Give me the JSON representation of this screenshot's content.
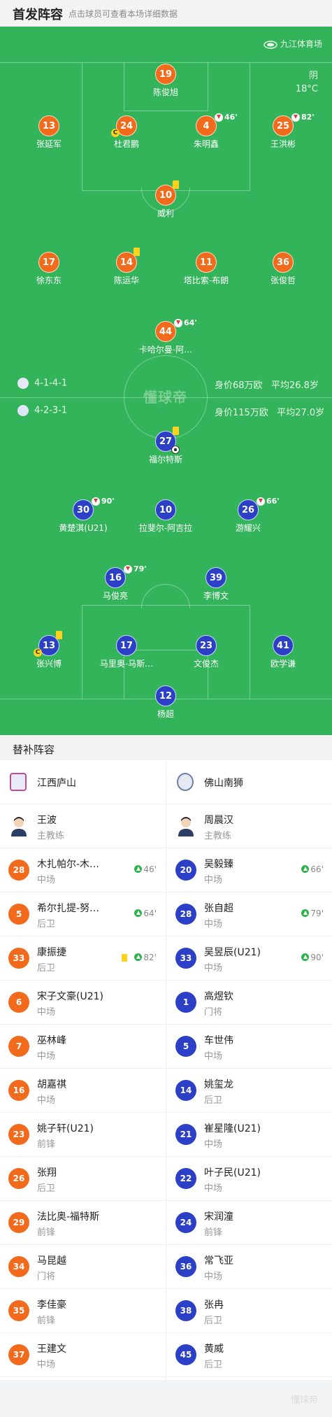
{
  "header": {
    "title": "首发阵容",
    "subtitle": "点击球员可查看本场详细数据"
  },
  "venue": {
    "name": "九江体育场",
    "icon": "stadium-icon"
  },
  "weather": {
    "condition": "阴",
    "temperature": "18°C"
  },
  "watermark": "懂球帝",
  "home_team": {
    "name": "江西庐山",
    "formation": "4-1-4-1",
    "value": "身价68万欧",
    "age": "平均26.8岁",
    "color": "#f26b1d"
  },
  "away_team": {
    "name": "佛山南狮",
    "formation": "4-2-3-1",
    "value": "身价115万欧",
    "age": "平均27.0岁",
    "color": "#2b3fc7"
  },
  "home_lineup": [
    {
      "num": "19",
      "name": "陈俊旭"
    },
    {
      "num": "13",
      "name": "张延军"
    },
    {
      "num": "24",
      "name": "杜君鹏",
      "captain": "C"
    },
    {
      "num": "4",
      "name": "朱明鑫",
      "sub_min": "46'"
    },
    {
      "num": "25",
      "name": "王洪彬",
      "sub_min": "82'"
    },
    {
      "num": "10",
      "name": "威利",
      "yellow": true
    },
    {
      "num": "17",
      "name": "徐东东"
    },
    {
      "num": "14",
      "name": "陈运华",
      "yellow": true
    },
    {
      "num": "11",
      "name": "塔比索-布朗"
    },
    {
      "num": "36",
      "name": "张俊哲"
    },
    {
      "num": "44",
      "name": "卡哈尔曼-阿…",
      "sub_min": "64'"
    }
  ],
  "away_lineup": [
    {
      "num": "27",
      "name": "福尔特斯",
      "yellow": true,
      "goal": true
    },
    {
      "num": "30",
      "name": "黄楚淇(U21)",
      "sub_min": "90'"
    },
    {
      "num": "10",
      "name": "拉斐尔-阿吉拉"
    },
    {
      "num": "26",
      "name": "游耀兴",
      "sub_min": "66'"
    },
    {
      "num": "16",
      "name": "马俊亮",
      "sub_min": "79'"
    },
    {
      "num": "39",
      "name": "李博文"
    },
    {
      "num": "13",
      "name": "张兴博",
      "yellow": true,
      "captain": "C"
    },
    {
      "num": "17",
      "name": "马里奥-马斯…"
    },
    {
      "num": "23",
      "name": "文俊杰"
    },
    {
      "num": "41",
      "name": "欧学谦"
    },
    {
      "num": "12",
      "name": "杨超"
    }
  ],
  "subs_title": "替补阵容",
  "home_coach": {
    "name": "王波",
    "role": "主教练"
  },
  "away_coach": {
    "name": "周晨汉",
    "role": "主教练"
  },
  "home_subs": [
    {
      "num": "28",
      "name": "木扎帕尔-木…",
      "pos": "中场",
      "in": "46'"
    },
    {
      "num": "5",
      "name": "希尔扎提-努…",
      "pos": "后卫",
      "in": "64'"
    },
    {
      "num": "33",
      "name": "康振捷",
      "pos": "后卫",
      "in": "82'",
      "yellow": true
    },
    {
      "num": "6",
      "name": "宋子文豪(U21)",
      "pos": "中场"
    },
    {
      "num": "7",
      "name": "巫林峰",
      "pos": "中场"
    },
    {
      "num": "16",
      "name": "胡嘉祺",
      "pos": "中场"
    },
    {
      "num": "23",
      "name": "姚子轩(U21)",
      "pos": "前锋"
    },
    {
      "num": "26",
      "name": "张翔",
      "pos": "后卫"
    },
    {
      "num": "29",
      "name": "法比奥-福特斯",
      "pos": "前锋"
    },
    {
      "num": "34",
      "name": "马昆越",
      "pos": "门将"
    },
    {
      "num": "35",
      "name": "李佳豪",
      "pos": "前锋"
    },
    {
      "num": "37",
      "name": "王建文",
      "pos": "中场"
    }
  ],
  "away_subs": [
    {
      "num": "20",
      "name": "吴毅臻",
      "pos": "中场",
      "in": "66'"
    },
    {
      "num": "28",
      "name": "张自超",
      "pos": "中场",
      "in": "79'"
    },
    {
      "num": "33",
      "name": "吴昱辰(U21)",
      "pos": "中场",
      "in": "90'"
    },
    {
      "num": "1",
      "name": "高煜钦",
      "pos": "门将"
    },
    {
      "num": "5",
      "name": "车世伟",
      "pos": "中场"
    },
    {
      "num": "14",
      "name": "姚玺龙",
      "pos": "后卫"
    },
    {
      "num": "21",
      "name": "崔星隆(U21)",
      "pos": "中场"
    },
    {
      "num": "22",
      "name": "叶子民(U21)",
      "pos": "中场"
    },
    {
      "num": "24",
      "name": "宋润潼",
      "pos": "前锋"
    },
    {
      "num": "36",
      "name": "常飞亚",
      "pos": "中场"
    },
    {
      "num": "38",
      "name": "张冉",
      "pos": "后卫"
    },
    {
      "num": "45",
      "name": "黄威",
      "pos": "后卫"
    }
  ],
  "footer": "懂球帝"
}
